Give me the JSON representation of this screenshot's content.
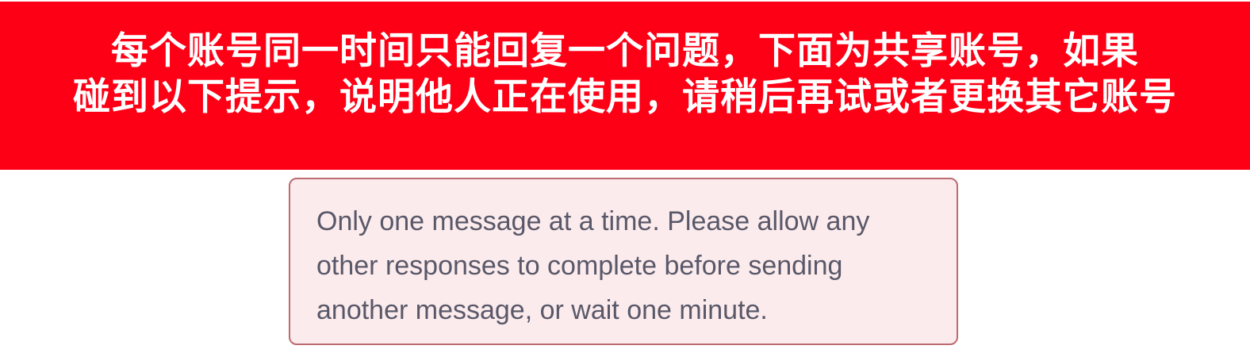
{
  "banner": {
    "line1": "每个账号同一时间只能回复一个问题，下面为共享账号，如果",
    "line2": "碰到以下提示，说明他人正在使用，请稍后再试或者更换其它账号",
    "background_color": "#fd0016",
    "text_color": "#ffffff"
  },
  "error_message": {
    "line1": "Only one message at a time. Please allow any",
    "line2": "other responses to complete before sending",
    "line3": "another message, or wait one minute.",
    "background_color": "#fbebec",
    "border_color": "#bd6a71",
    "text_color": "#595869"
  }
}
